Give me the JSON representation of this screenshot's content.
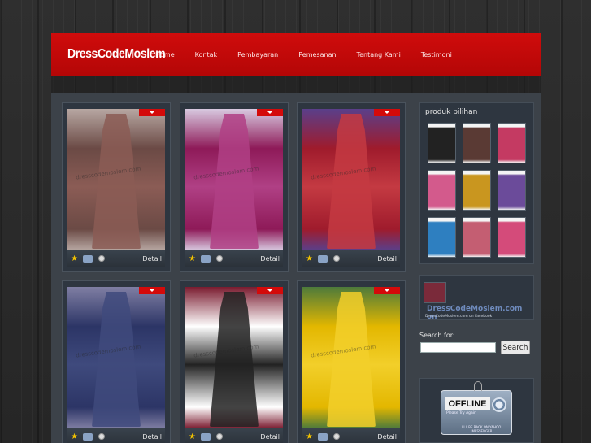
{
  "site": {
    "logo": "DressCodeMoslem"
  },
  "nav": {
    "items": [
      "Home",
      "Kontak",
      "Pembayaran",
      "Pemesanan",
      "Tentang Kami",
      "Testimoni"
    ]
  },
  "products": [
    {
      "detail_label": "Detail",
      "watermark": "dresscodemoslem.com",
      "colors": [
        "#6b4a45",
        "#8b5c55",
        "#b7a7a2"
      ]
    },
    {
      "detail_label": "Detail",
      "watermark": "dresscodemoslem.com",
      "colors": [
        "#8e1a58",
        "#b04085",
        "#d8c9e0"
      ]
    },
    {
      "detail_label": "Detail",
      "watermark": "dresscodemoslem.com",
      "colors": [
        "#9f1b2c",
        "#c43a42",
        "#5a3f8a"
      ]
    },
    {
      "detail_label": "Detail",
      "watermark": "dresscodemoslem.com",
      "colors": [
        "#2c3566",
        "#3f4a7d",
        "#7f7ea3"
      ]
    },
    {
      "detail_label": "Detail",
      "watermark": "dresscodemoslem.com",
      "colors": [
        "#ffffff",
        "#222222",
        "#7a1b2f"
      ]
    },
    {
      "detail_label": "Detail",
      "watermark": "dresscodemoslem.com",
      "colors": [
        "#e3b700",
        "#f2cf2a",
        "#4d7a3b"
      ]
    }
  ],
  "sidebar": {
    "produk_title": "produk pilihan",
    "thumbs": [
      "#222",
      "#5a3a34",
      "#c43a62",
      "#d35a8c",
      "#c9961f",
      "#6b4b9a",
      "#2e7fc0",
      "#c45e72",
      "#d44b7a"
    ],
    "facebook": {
      "title": "DressCodeMoslem.com on",
      "sub": "DressCodeMoslem.com on Facebook"
    },
    "search": {
      "label": "Search for:",
      "button": "Search",
      "placeholder": ""
    },
    "offline": {
      "title": "OFFLINE",
      "tagline": "Please Try Again",
      "note": "I'LL BE BACK ON YAHOO! MESSENGER"
    }
  }
}
